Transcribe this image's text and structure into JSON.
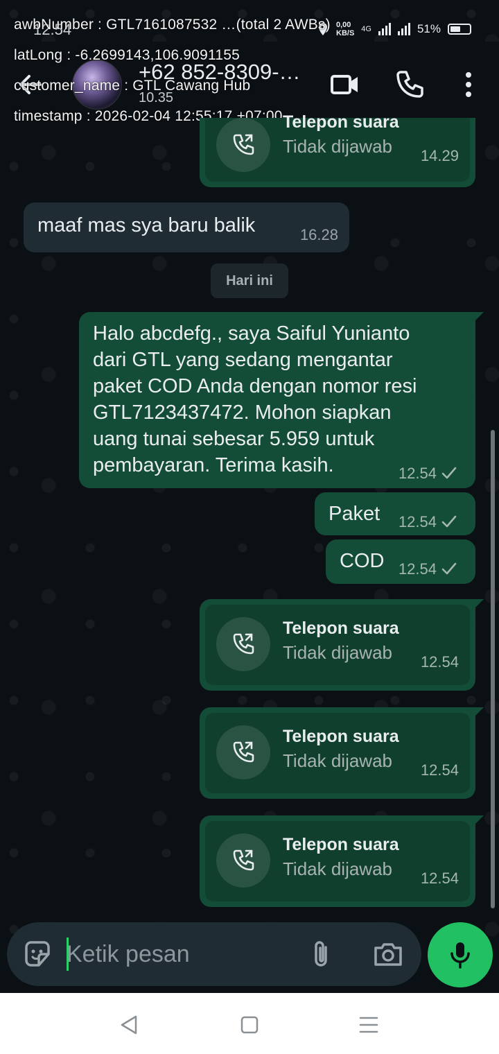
{
  "status_bar": {
    "time": "12.54",
    "net_speed_top": "0,00",
    "net_speed_unit": "KB/S",
    "network": "4G",
    "battery": "51%"
  },
  "overlay": {
    "awb": "awbNumber : GTL7161087532 …(total 2 AWBs)",
    "latlong": "latLong : -6.2699143,106.9091155",
    "customer": "customer_name : GTL Cawang Hub",
    "timestamp": "timestamp : 2026-02-04 12:55:17 +07:00"
  },
  "header": {
    "contact": "+62 852-8309-…",
    "subtitle": "10.35"
  },
  "messages": {
    "call0": {
      "title": "Telepon suara",
      "status": "Tidak dijawab",
      "time": "14.29"
    },
    "in1": {
      "text": "maaf mas sya baru balik",
      "time": "16.28"
    },
    "date_chip": "Hari ini",
    "out1": {
      "lines": [
        "Halo abcdefg., saya Saiful Yunianto",
        "dari GTL yang sedang mengantar",
        "paket COD Anda dengan nomor resi",
        "GTL7123437472. Mohon siapkan",
        "uang tunai sebesar 5.959 untuk",
        "pembayaran. Terima kasih."
      ],
      "time": "12.54"
    },
    "out2": {
      "text": "Paket",
      "time": "12.54"
    },
    "out3": {
      "text": "COD",
      "time": "12.54"
    },
    "call1": {
      "title": "Telepon suara",
      "status": "Tidak dijawab",
      "time": "12.54"
    },
    "call2": {
      "title": "Telepon suara",
      "status": "Tidak dijawab",
      "time": "12.54"
    },
    "call3": {
      "title": "Telepon suara",
      "status": "Tidak dijawab",
      "time": "12.54"
    }
  },
  "composer": {
    "placeholder": "Ketik pesan"
  },
  "colors": {
    "accent": "#21c063",
    "bubble_out": "#144d37",
    "bubble_in": "#1f2c34",
    "background": "#0b1014"
  }
}
